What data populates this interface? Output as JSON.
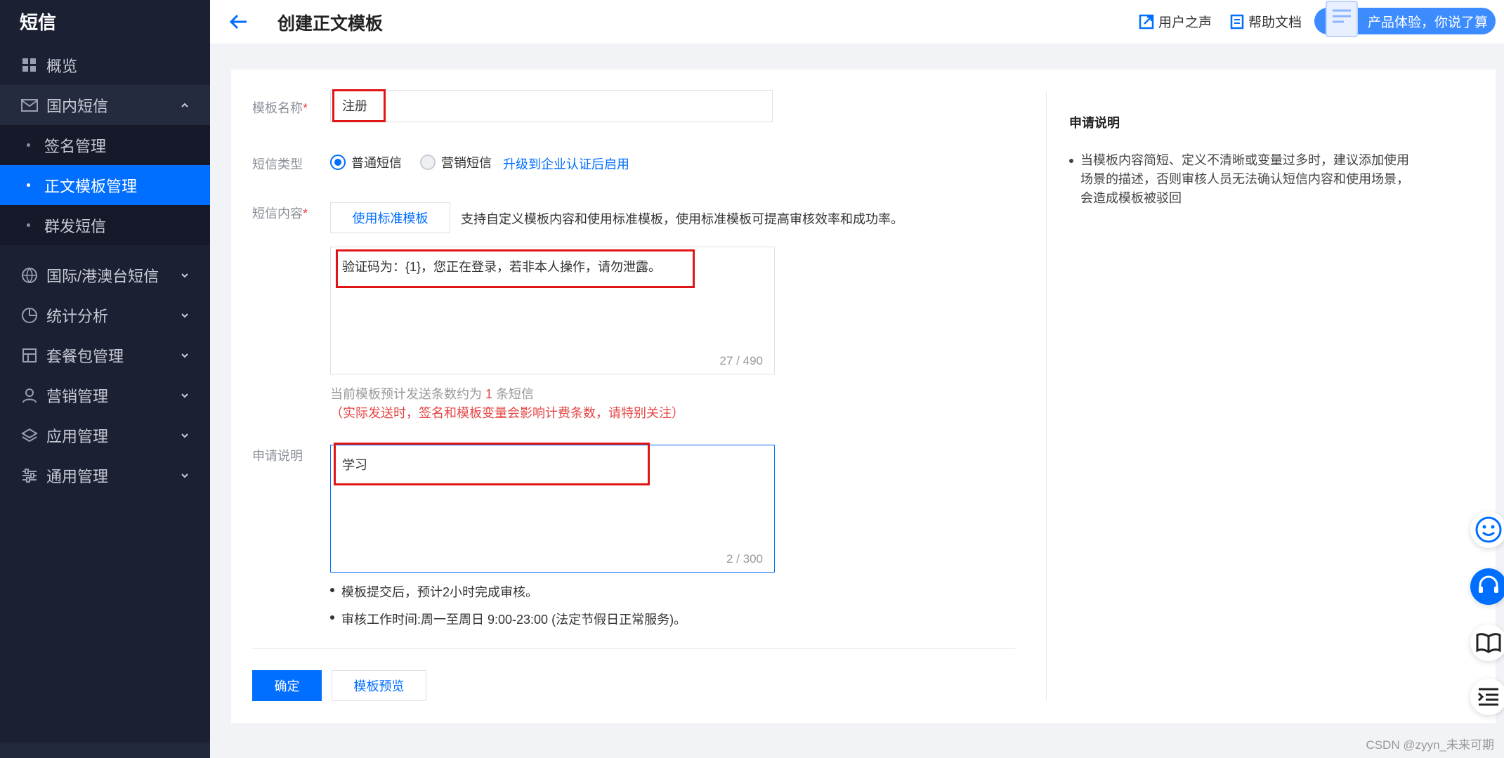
{
  "sidebar": {
    "brand": "短信",
    "overview": "概览",
    "domestic": "国内短信",
    "sub_items": [
      "签名管理",
      "正文模板管理",
      "群发短信"
    ],
    "international": "国际/港澳台短信",
    "stats": "统计分析",
    "packages": "套餐包管理",
    "marketing": "营销管理",
    "apps": "应用管理",
    "general": "通用管理"
  },
  "header": {
    "title": "创建正文模板",
    "user_voice": "用户之声",
    "help_docs": "帮助文档",
    "promo": "产品体验，你说了算"
  },
  "form": {
    "name_label": "模板名称",
    "required_mark": "*",
    "name_value": "注册",
    "type_label": "短信类型",
    "type_normal": "普通短信",
    "type_marketing": "营销短信",
    "upgrade_link": "升级到企业认证后启用",
    "content_label": "短信内容",
    "std_template_button": "使用标准模板",
    "content_tip": "支持自定义模板内容和使用标准模板，使用标准模板可提高审核效率和成功率。",
    "content_value": "验证码为：{1}，您正在登录，若非本人操作，请勿泄露。",
    "content_counter": "27 / 490",
    "estimate_prefix": "当前模板预计发送条数约为",
    "estimate_count": "1",
    "estimate_suffix": "条短信",
    "estimate_warning": "（实际发送时，签名和模板变量会影响计费条数，请特别关注）",
    "remark_label": "申请说明",
    "remark_value": "学习",
    "remark_counter": "2 / 300",
    "note1": "模板提交后，预计2小时完成审核。",
    "note2": "审核工作时间:周一至周日 9:00-23:00 (法定节假日正常服务)。",
    "confirm_button": "确定",
    "preview_button": "模板预览"
  },
  "side_panel": {
    "title": "申请说明",
    "text": "当模板内容简短、定义不清晰或变量过多时，建议添加使用场景的描述，否则审核人员无法确认短信内容和使用场景，会造成模板被驳回"
  },
  "watermark": "CSDN @zyyn_未来可期",
  "colors": {
    "primary": "#006eff",
    "sidebar_bg": "#1b2033",
    "highlight_red": "#e01616"
  }
}
